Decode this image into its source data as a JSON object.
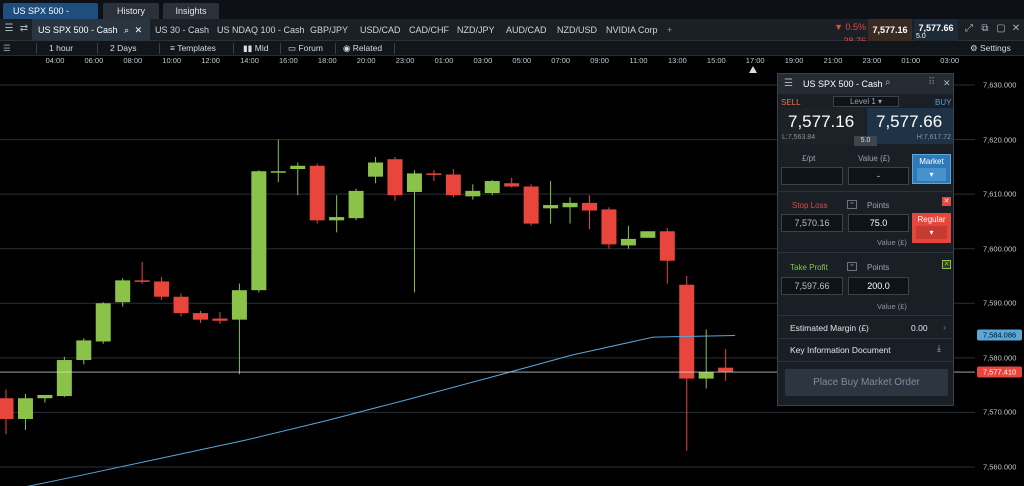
{
  "window_tabs": [
    {
      "label": "US SPX 500 - Cash",
      "active": true
    },
    {
      "label": "History",
      "active": false
    },
    {
      "label": "Insights",
      "active": false
    }
  ],
  "instrument_tabs": {
    "active": "US SPX 500 - Cash",
    "others": [
      "US 30 - Cash",
      "US NDAQ 100 - Cash",
      "GBP/JPY",
      "USD/CAD",
      "CAD/CHF",
      "NZD/JPY",
      "AUD/CAD",
      "NZD/USD",
      "NVIDIA Corp"
    ],
    "add_label": "+"
  },
  "quote": {
    "change_pct": "▼ 0.5%",
    "change_pts": "38.76",
    "sell": "7,577.16",
    "buy": "7,577.66",
    "spread": "5.0"
  },
  "chart_toolbar": {
    "interval": "1 hour",
    "range": "2 Days",
    "templates": "Templates",
    "mid": "Mid",
    "forum": "Forum",
    "related": "Related",
    "settings": "Settings"
  },
  "time_labels": [
    "04:00",
    "06:00",
    "08:00",
    "10:00",
    "12:00",
    "14:00",
    "16:00",
    "18:00",
    "20:00",
    "23:00",
    "01:00",
    "03:00",
    "05:00",
    "07:00",
    "09:00",
    "11:00",
    "13:00",
    "15:00",
    "17:00",
    "19:00",
    "21:00",
    "23:00",
    "01:00",
    "03:00"
  ],
  "price_labels": [
    "7,630.000",
    "7,620.000",
    "7,610.000",
    "7,600.000",
    "7,590.000",
    "7,580.000",
    "7,570.000",
    "7,560.000"
  ],
  "badges": {
    "ma_value": "7,584.086",
    "current_price": "7,577.410"
  },
  "colors": {
    "up": "#8bc34a",
    "down": "#e8463c",
    "ma_line": "#5aa7d8",
    "accent_blue": "#3f8fd0"
  },
  "chart_data": {
    "type": "candlestick",
    "ylim": [
      7556,
      7634
    ],
    "candles": [
      {
        "o": 7572.6,
        "h": 7574.2,
        "l": 7566.0,
        "c": 7568.8
      },
      {
        "o": 7568.8,
        "h": 7573.4,
        "l": 7566.8,
        "c": 7572.6
      },
      {
        "o": 7572.6,
        "h": 7573.2,
        "l": 7571.8,
        "c": 7573.2
      },
      {
        "o": 7573.0,
        "h": 7580.2,
        "l": 7572.8,
        "c": 7579.6
      },
      {
        "o": 7579.6,
        "h": 7583.6,
        "l": 7578.8,
        "c": 7583.2
      },
      {
        "o": 7583.0,
        "h": 7590.2,
        "l": 7582.6,
        "c": 7590.0
      },
      {
        "o": 7590.2,
        "h": 7594.6,
        "l": 7589.4,
        "c": 7594.2
      },
      {
        "o": 7594.2,
        "h": 7597.6,
        "l": 7593.6,
        "c": 7594.0
      },
      {
        "o": 7594.0,
        "h": 7594.8,
        "l": 7590.6,
        "c": 7591.2
      },
      {
        "o": 7591.2,
        "h": 7591.8,
        "l": 7587.6,
        "c": 7588.2
      },
      {
        "o": 7588.2,
        "h": 7588.6,
        "l": 7586.4,
        "c": 7587.0
      },
      {
        "o": 7587.2,
        "h": 7588.4,
        "l": 7586.2,
        "c": 7586.8
      },
      {
        "o": 7587.0,
        "h": 7593.6,
        "l": 7577.0,
        "c": 7592.4
      },
      {
        "o": 7592.4,
        "h": 7614.4,
        "l": 7592.0,
        "c": 7614.2
      },
      {
        "o": 7614.0,
        "h": 7620.0,
        "l": 7612.2,
        "c": 7614.2
      },
      {
        "o": 7614.6,
        "h": 7615.8,
        "l": 7609.8,
        "c": 7615.2
      },
      {
        "o": 7615.2,
        "h": 7615.6,
        "l": 7604.6,
        "c": 7605.2
      },
      {
        "o": 7605.2,
        "h": 7609.8,
        "l": 7603.0,
        "c": 7605.8
      },
      {
        "o": 7605.6,
        "h": 7611.0,
        "l": 7605.2,
        "c": 7610.6
      },
      {
        "o": 7613.2,
        "h": 7616.8,
        "l": 7612.0,
        "c": 7615.8
      },
      {
        "o": 7616.4,
        "h": 7616.8,
        "l": 7608.8,
        "c": 7609.8
      },
      {
        "o": 7610.4,
        "h": 7614.4,
        "l": 7592.0,
        "c": 7613.8
      },
      {
        "o": 7613.8,
        "h": 7614.4,
        "l": 7612.4,
        "c": 7613.6
      },
      {
        "o": 7613.6,
        "h": 7614.6,
        "l": 7609.4,
        "c": 7609.8
      },
      {
        "o": 7609.6,
        "h": 7611.8,
        "l": 7609.0,
        "c": 7610.6
      },
      {
        "o": 7610.2,
        "h": 7612.6,
        "l": 7609.8,
        "c": 7612.4
      },
      {
        "o": 7612.0,
        "h": 7613.0,
        "l": 7611.2,
        "c": 7611.4
      },
      {
        "o": 7611.4,
        "h": 7611.8,
        "l": 7604.2,
        "c": 7604.6
      },
      {
        "o": 7607.4,
        "h": 7612.4,
        "l": 7604.6,
        "c": 7608.0
      },
      {
        "o": 7607.6,
        "h": 7609.4,
        "l": 7604.6,
        "c": 7608.4
      },
      {
        "o": 7608.4,
        "h": 7609.8,
        "l": 7603.6,
        "c": 7607.0
      },
      {
        "o": 7607.2,
        "h": 7607.6,
        "l": 7600.0,
        "c": 7600.8
      },
      {
        "o": 7600.6,
        "h": 7604.2,
        "l": 7600.0,
        "c": 7601.8
      },
      {
        "o": 7602.0,
        "h": 7603.2,
        "l": 7602.0,
        "c": 7603.2
      },
      {
        "o": 7603.2,
        "h": 7603.8,
        "l": 7593.6,
        "c": 7597.8
      },
      {
        "o": 7593.4,
        "h": 7595.0,
        "l": 7563.0,
        "c": 7576.2
      },
      {
        "o": 7576.2,
        "h": 7585.2,
        "l": 7574.4,
        "c": 7577.4
      },
      {
        "o": 7578.2,
        "h": 7581.6,
        "l": 7575.8,
        "c": 7577.4
      }
    ],
    "moving_average": [
      7555.4,
      7558.5,
      7561.7,
      7564.9,
      7568.5,
      7572.4,
      7576.4,
      7580.5,
      7583.8,
      7584.1
    ]
  },
  "ticket": {
    "instrument": "US SPX 500 - Cash",
    "sell_label": "SELL",
    "buy_label": "BUY",
    "level": "Level 1",
    "sell_price": "7,577.16",
    "buy_price": "7,577.66",
    "low": "L:7,563.84",
    "high": "H:7,617.72",
    "spread": "5.0",
    "per_pt_label": "£/pt",
    "value_label": "Value (£)",
    "value": "-",
    "market_btn": "Market",
    "stop_loss_label": "Stop Loss",
    "points_label": "Points",
    "stop_loss_value": "7,570.16",
    "stop_loss_points": "75.0",
    "regular_btn": "Regular",
    "stop_value_label": "Value (£)",
    "take_profit_label": "Take Profit",
    "tp_points_label": "Points",
    "take_profit_value": "7,597.66",
    "take_profit_points": "200.0",
    "tp_value_label": "Value (£)",
    "est_margin_label": "Estimated Margin (£)",
    "est_margin_value": "0.00",
    "kid_label": "Key Information Document",
    "place_order": "Place Buy Market Order"
  }
}
